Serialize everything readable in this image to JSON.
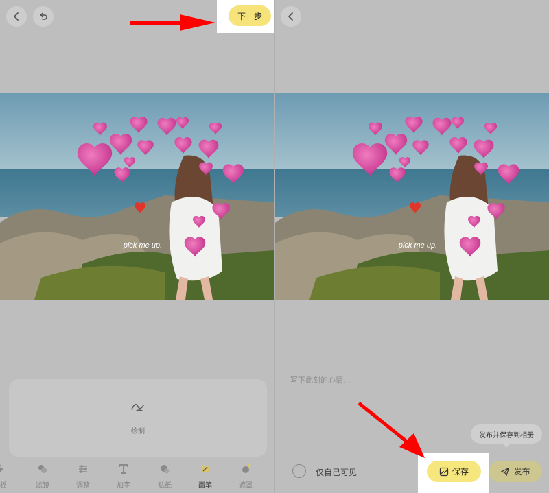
{
  "editor": {
    "next_label": "下一步",
    "draw_tool_label": "绘制",
    "photo_caption": "pick me up.",
    "toolbar": [
      {
        "label": "模板",
        "icon": "lightning-icon",
        "clipped": true
      },
      {
        "label": "滤镜",
        "icon": "filter-icon"
      },
      {
        "label": "调整",
        "icon": "sliders-icon"
      },
      {
        "label": "加字",
        "icon": "text-icon"
      },
      {
        "label": "贴纸",
        "icon": "sticker-icon"
      },
      {
        "label": "画笔",
        "icon": "brush-icon",
        "active": true
      },
      {
        "label": "遮罩",
        "icon": "mask-icon"
      }
    ]
  },
  "publish": {
    "photo_caption": "pick me up.",
    "caption_placeholder": "写下此刻的心情…",
    "tooltip": "发布并保存到相册",
    "private_label": "仅自己可见",
    "save_label": "保存",
    "publish_label": "发布"
  },
  "colors": {
    "accent_yellow": "#f6e37a",
    "annotation_red": "#ff0000",
    "overlay_gray": "#bebebe"
  }
}
